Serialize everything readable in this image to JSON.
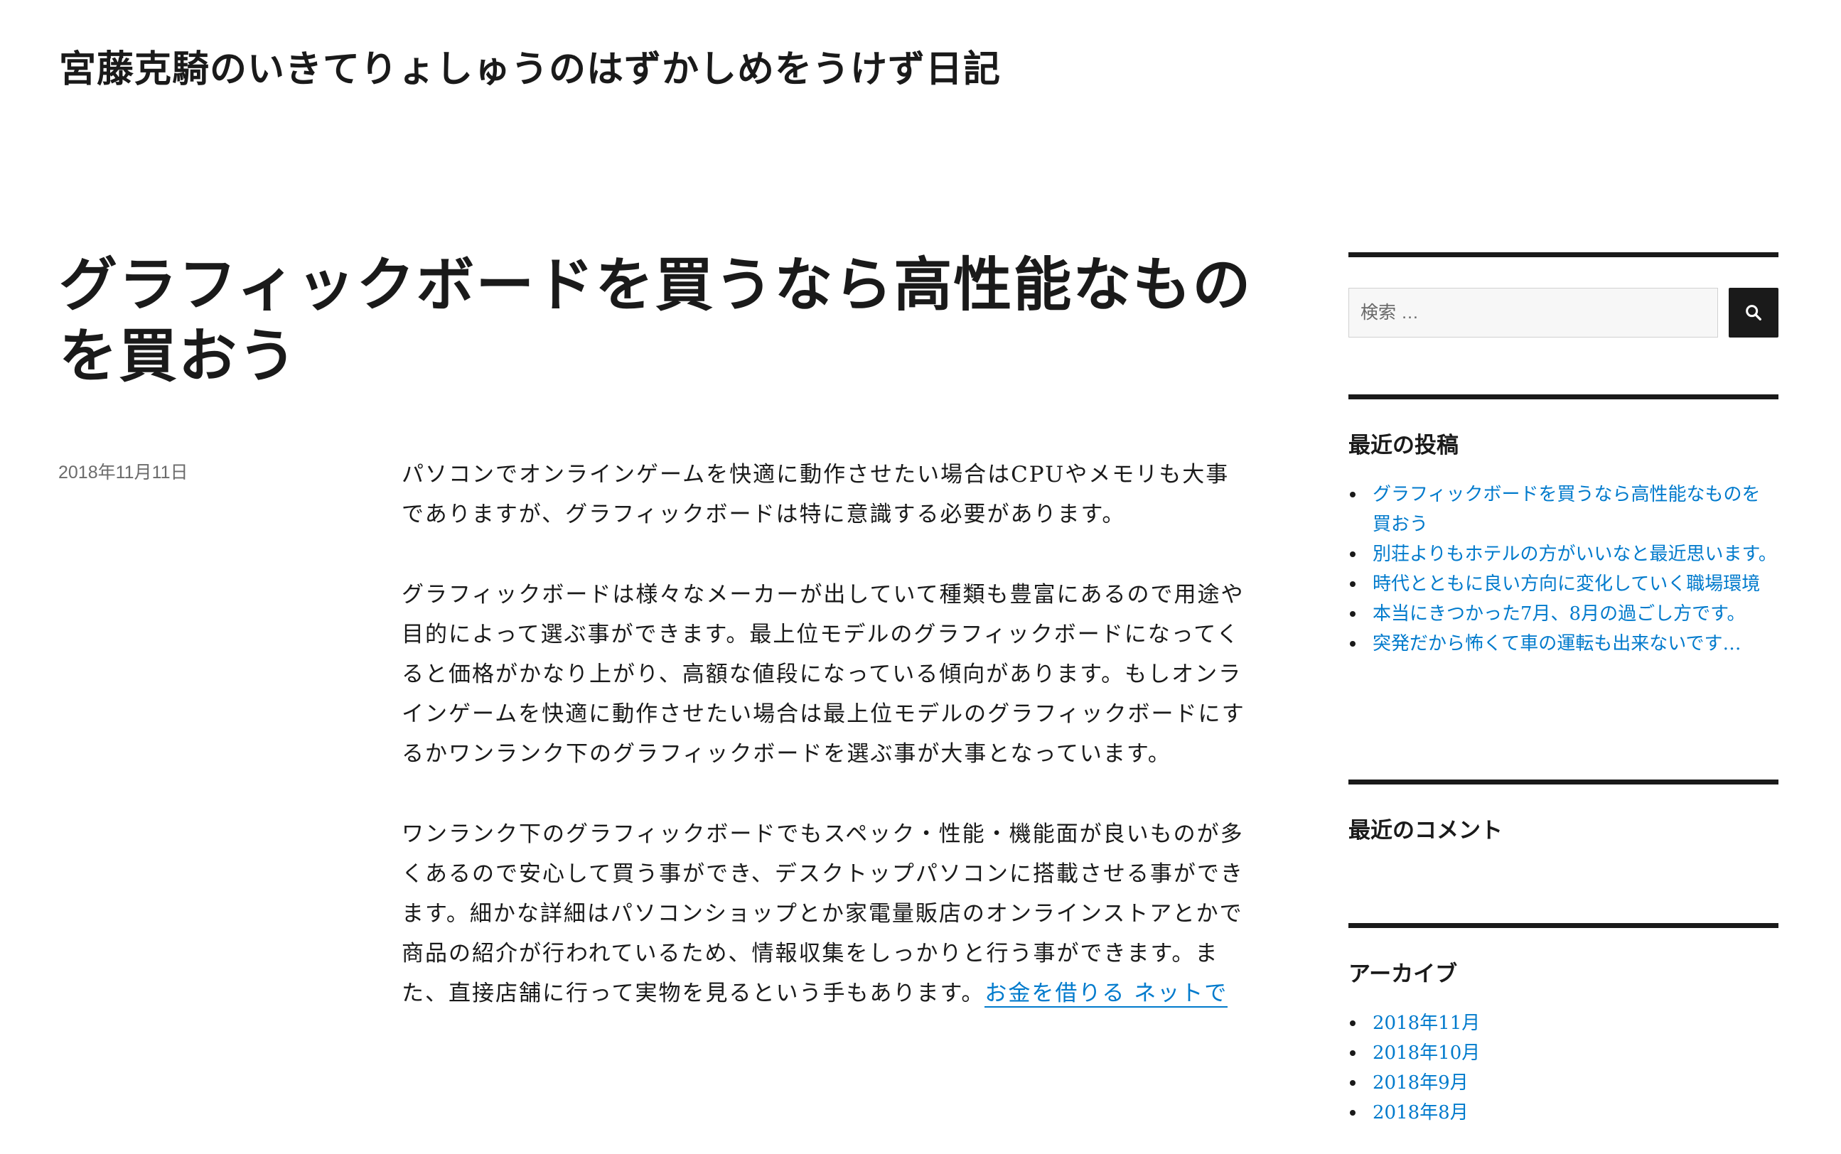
{
  "site": {
    "title": "宮藤克騎のいきてりょしゅうのはずかしめをうけず日記"
  },
  "post": {
    "title": "グラフィックボードを買うなら高性能なものを買おう",
    "date": "2018年11月11日",
    "paragraphs": [
      "パソコンでオンラインゲームを快適に動作させたい場合はCPUやメモリも大事でありますが、グラフィックボードは特に意識する必要があります。",
      "グラフィックボードは様々なメーカーが出していて種類も豊富にあるので用途や目的によって選ぶ事ができます。最上位モデルのグラフィックボードになってくると価格がかなり上がり、高額な値段になっている傾向があります。もしオンラインゲームを快適に動作させたい場合は最上位モデルのグラフィックボードにするかワンランク下のグラフィックボードを選ぶ事が大事となっています。",
      "ワンランク下のグラフィックボードでもスペック・性能・機能面が良いものが多くあるので安心して買う事ができ、デスクトップパソコンに搭載させる事ができます。細かな詳細はパソコンショップとか家電量販店のオンラインストアとかで商品の紹介が行われているため、情報収集をしっかりと行う事ができます。また、直接店舗に行って実物を見るという手もあります。"
    ],
    "link_text": "お金を借りる ネットで"
  },
  "sidebar": {
    "search": {
      "placeholder": "検索 …",
      "icon": "search-icon"
    },
    "recent_posts": {
      "title": "最近の投稿",
      "items": [
        "グラフィックボードを買うなら高性能なものを買おう",
        "別荘よりもホテルの方がいいなと最近思います。",
        "時代とともに良い方向に変化していく職場環境",
        "本当にきつかった7月、8月の過ごし方です。",
        "突発だから怖くて車の運転も出来ないです…"
      ]
    },
    "recent_comments": {
      "title": "最近のコメント"
    },
    "archives": {
      "title": "アーカイブ",
      "items": [
        "2018年11月",
        "2018年10月",
        "2018年9月",
        "2018年8月"
      ]
    }
  },
  "colors": {
    "link": "#007acc",
    "text": "#1a1a1a",
    "meta": "#6b6b6b"
  }
}
